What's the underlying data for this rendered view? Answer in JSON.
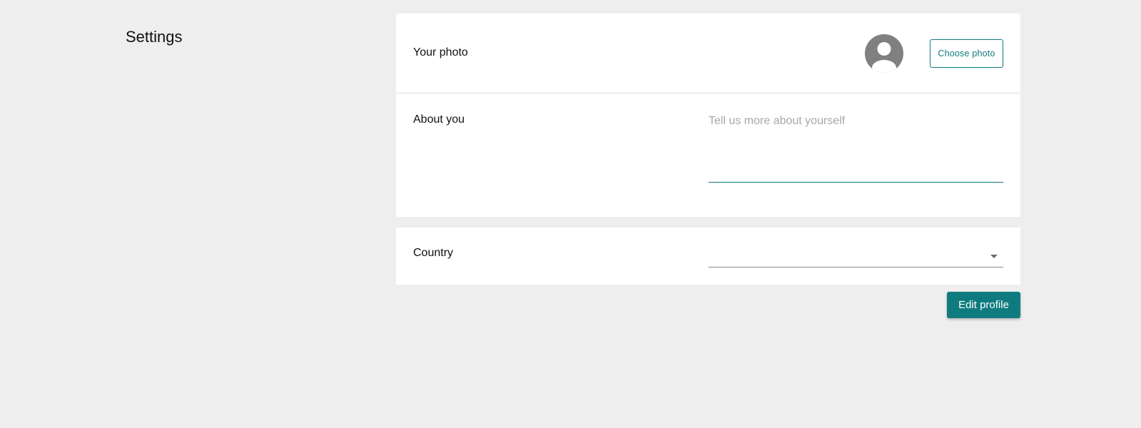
{
  "page": {
    "title": "Settings"
  },
  "profile": {
    "photo_label": "Your photo",
    "avatar_icon": "user-avatar-icon",
    "choose_photo_label": "Choose photo",
    "about_label": "About you",
    "about_value": "",
    "about_placeholder": "Tell us more about yourself"
  },
  "country": {
    "label": "Country",
    "selected_value": "",
    "dropdown_icon": "chevron-down-icon"
  },
  "actions": {
    "edit_profile_label": "Edit profile"
  },
  "colors": {
    "background": "#eeeeee",
    "card": "#ffffff",
    "accent": "#0f7b7f",
    "avatar": "#808080",
    "placeholder": "#a8a8a8"
  }
}
